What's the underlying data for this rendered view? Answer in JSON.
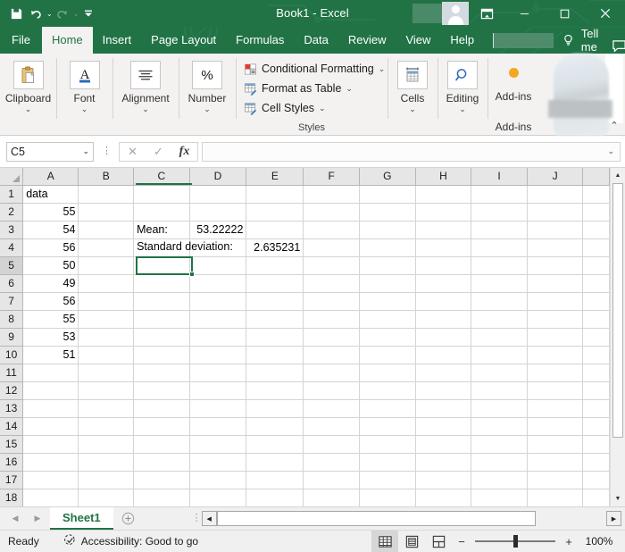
{
  "titlebar": {
    "document_title": "Book1  -  Excel",
    "qat": [
      {
        "name": "save",
        "label": "Save"
      },
      {
        "name": "undo",
        "label": "Undo"
      },
      {
        "name": "redo",
        "label": "Redo"
      },
      {
        "name": "customize",
        "label": "Customize Quick Access Toolbar"
      }
    ],
    "ribbon_display_options": "Ribbon Display Options",
    "minimize": "Minimize",
    "maximize": "Maximize",
    "close": "Close",
    "accent_color": "#217346"
  },
  "tabs": [
    {
      "label": "File",
      "active": false
    },
    {
      "label": "Home",
      "active": true
    },
    {
      "label": "Insert",
      "active": false
    },
    {
      "label": "Page Layout",
      "active": false
    },
    {
      "label": "Formulas",
      "active": false
    },
    {
      "label": "Data",
      "active": false
    },
    {
      "label": "Review",
      "active": false
    },
    {
      "label": "View",
      "active": false
    },
    {
      "label": "Help",
      "active": false
    }
  ],
  "tellme": {
    "label": "Tell me",
    "icon": "lightbulb-icon"
  },
  "ribbon": {
    "groups": [
      {
        "name": "clipboard",
        "label": "Clipboard",
        "icon": "clipboard-icon",
        "chevron": "⌄"
      },
      {
        "name": "font",
        "label": "Font",
        "icon": "font-icon",
        "chevron": "⌄"
      },
      {
        "name": "alignment",
        "label": "Alignment",
        "icon": "alignment-icon",
        "chevron": "⌄"
      },
      {
        "name": "number",
        "label": "Number",
        "icon": "percent-icon",
        "chevron": "⌄"
      }
    ],
    "styles": {
      "group_label": "Styles",
      "items": [
        {
          "label": "Conditional Formatting",
          "icon": "conditional-formatting-icon",
          "chevron": "⌄"
        },
        {
          "label": "Format as Table",
          "icon": "format-as-table-icon",
          "chevron": "⌄"
        },
        {
          "label": "Cell Styles",
          "icon": "cell-styles-icon",
          "chevron": "⌄"
        }
      ]
    },
    "cells": {
      "label": "Cells",
      "icon": "cells-icon",
      "chevron": "⌄"
    },
    "editing": {
      "label": "Editing",
      "icon": "magnifier-icon",
      "chevron": "⌄"
    },
    "addins": {
      "label": "Add-ins",
      "group_label": "Add-ins",
      "icon": "addin-dot-icon",
      "dot_color": "#f5a623"
    },
    "collapse": "⌃"
  },
  "formulabar": {
    "namebox_value": "C5",
    "namebox_chevron": "⌄",
    "cancel_icon": "✕",
    "enter_icon": "✓",
    "function_icon": "fx",
    "formula_value": "",
    "expand_chevron": "⌄"
  },
  "grid": {
    "columns": [
      "A",
      "B",
      "C",
      "D",
      "E",
      "F",
      "G",
      "H",
      "I",
      "J"
    ],
    "rows": [
      1,
      2,
      3,
      4,
      5,
      6,
      7,
      8,
      9,
      10,
      11,
      12,
      13,
      14,
      15,
      16,
      17,
      18
    ],
    "selected_cell": "C5",
    "selected_column": "C",
    "selected_row": 5,
    "cells": {
      "A1": {
        "value": "data",
        "align": "left"
      },
      "A2": {
        "value": "55",
        "align": "right"
      },
      "A3": {
        "value": "54",
        "align": "right"
      },
      "A4": {
        "value": "56",
        "align": "right"
      },
      "A5": {
        "value": "50",
        "align": "right"
      },
      "A6": {
        "value": "49",
        "align": "right"
      },
      "A7": {
        "value": "56",
        "align": "right"
      },
      "A8": {
        "value": "55",
        "align": "right"
      },
      "A9": {
        "value": "53",
        "align": "right"
      },
      "A10": {
        "value": "51",
        "align": "right"
      },
      "C3": {
        "value": "Mean:",
        "align": "left"
      },
      "D3": {
        "value": "53.22222",
        "align": "right"
      },
      "C4": {
        "value": "Standard deviation:",
        "align": "left",
        "spill": true
      },
      "E4": {
        "value": "2.635231",
        "align": "right"
      }
    }
  },
  "sheettabs": {
    "prev_icon": "◀",
    "next_icon": "▶",
    "sheets": [
      {
        "label": "Sheet1",
        "active": true
      }
    ],
    "add_sheet_icon": "＋",
    "split_icon": "⋮"
  },
  "statusbar": {
    "mode": "Ready",
    "accessibility": "Accessibility: Good to go",
    "accessibility_icon": "accessibility-icon",
    "views": [
      {
        "name": "normal-view",
        "active": true
      },
      {
        "name": "page-layout-view",
        "active": false
      },
      {
        "name": "page-break-preview",
        "active": false
      }
    ],
    "zoom_out": "−",
    "zoom_in": "+",
    "zoom_level": "100%"
  }
}
